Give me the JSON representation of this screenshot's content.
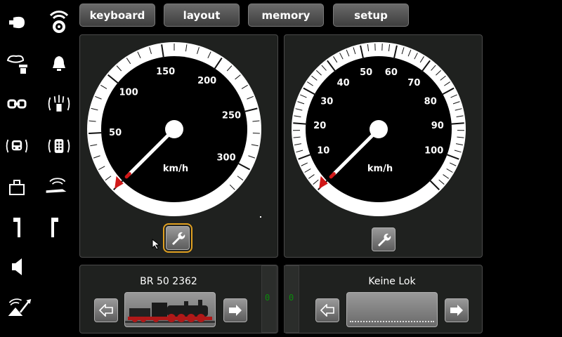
{
  "tabs": [
    {
      "label": "keyboard"
    },
    {
      "label": "layout"
    },
    {
      "label": "memory"
    },
    {
      "label": "setup"
    }
  ],
  "left_gauge": {
    "unit": "km/h",
    "max": 320,
    "labels": [
      "50",
      "100",
      "150",
      "200",
      "250",
      "300"
    ],
    "label_values": [
      50,
      100,
      150,
      200,
      250,
      300
    ],
    "speed": 0
  },
  "right_gauge": {
    "unit": "km/h",
    "max": 110,
    "labels": [
      "10",
      "20",
      "30",
      "40",
      "50",
      "60",
      "70",
      "80",
      "90",
      "100"
    ],
    "label_values": [
      10,
      20,
      30,
      40,
      50,
      60,
      70,
      80,
      90,
      100
    ],
    "speed": 0
  },
  "left_loco": {
    "name": "BR 50 2362",
    "meter_value": "0"
  },
  "right_loco": {
    "name": "Keine Lok",
    "meter_value": "0"
  },
  "colors": {
    "accent": "#e0a020",
    "needle_tip": "#d01818",
    "panel": "#1f211f"
  }
}
